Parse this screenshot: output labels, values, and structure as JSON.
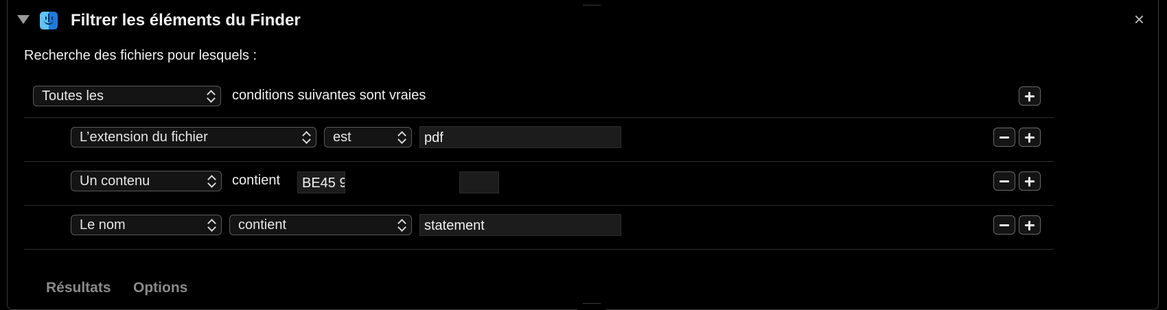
{
  "header": {
    "title": "Filtrer les éléments du Finder",
    "close_glyph": "×",
    "icon": "finder-icon"
  },
  "subtitle": "Recherche des fichiers pour lesquels :",
  "match": {
    "quantifier": "Toutes les",
    "suffix": "conditions suivantes sont vraies"
  },
  "conditions": [
    {
      "attribute": "L’extension du fichier",
      "operator": "est",
      "value": "pdf"
    },
    {
      "attribute": "Un contenu",
      "operator": "contient",
      "value": "BE45 9"
    },
    {
      "attribute": "Le nom",
      "operator": "contient",
      "value": "statement"
    }
  ],
  "tabs": [
    "Résultats",
    "Options"
  ],
  "colors": {
    "background": "#000000",
    "border": "#3a3a3a",
    "text": "#f0f0f0",
    "tab_inactive": "#8a8a8a"
  }
}
